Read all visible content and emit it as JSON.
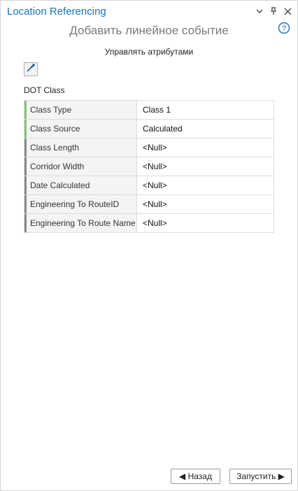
{
  "pane": {
    "title": "Location Referencing",
    "subtitle": "Добавить линейное событие"
  },
  "section": {
    "title": "Управлять атрибутами"
  },
  "layer": {
    "name": "DOT Class"
  },
  "attributes": [
    {
      "name": "Class Type",
      "value": "Class 1",
      "required": true
    },
    {
      "name": "Class Source",
      "value": "Calculated",
      "required": true
    },
    {
      "name": "Class Length",
      "value": "<Null>",
      "required": false
    },
    {
      "name": "Corridor Width",
      "value": "<Null>",
      "required": false
    },
    {
      "name": "Date Calculated",
      "value": "<Null>",
      "required": false
    },
    {
      "name": "Engineering To RouteID",
      "value": "<Null>",
      "required": false
    },
    {
      "name": "Engineering To Route Name",
      "value": "<Null>",
      "required": false
    }
  ],
  "footer": {
    "back_label": "◀ Назад",
    "run_label": "Запустить ▶"
  },
  "colors": {
    "title": "#1a73b8",
    "required_marker": "#8cc07f",
    "optional_marker": "#8a8a8a"
  },
  "icons": {
    "pick": "eyedropper-icon",
    "help": "help-icon",
    "dropdown": "chevron-down-icon",
    "pin": "pin-icon",
    "close": "close-icon"
  }
}
